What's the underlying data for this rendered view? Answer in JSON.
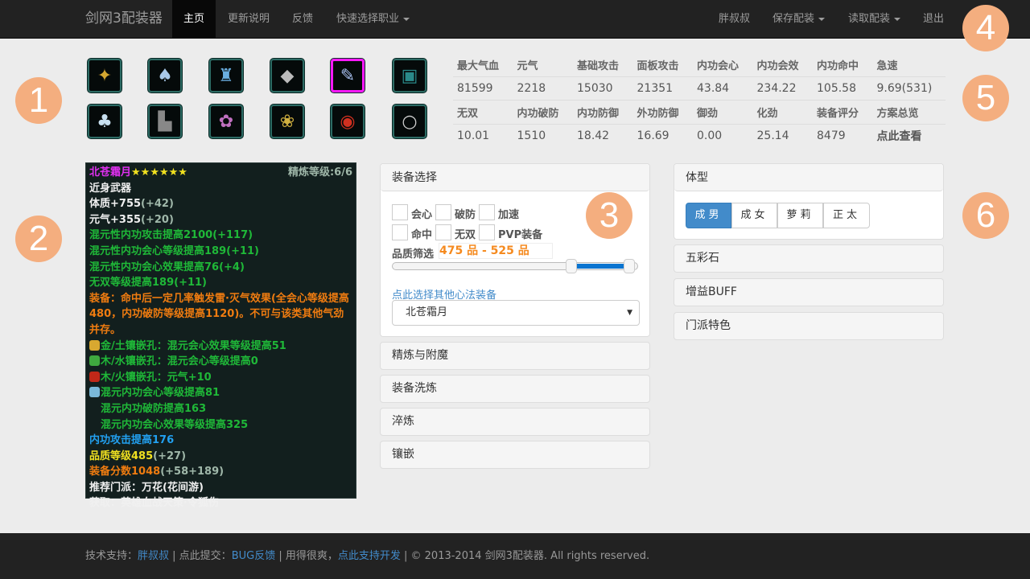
{
  "navbar": {
    "brand": "剑网3配装器",
    "items": [
      "主页",
      "更新说明",
      "反馈",
      "快速选择职业"
    ],
    "right_items": [
      "胖叔叔",
      "保存配装",
      "读取配装",
      "退出"
    ]
  },
  "badges": [
    "1",
    "2",
    "3",
    "4",
    "5",
    "6"
  ],
  "equipment_slots": [
    {
      "slot": "necklace-ornament",
      "glyph": "✦",
      "color": "#d4a630"
    },
    {
      "slot": "chest",
      "glyph": "♠",
      "color": "#a8c8e8"
    },
    {
      "slot": "belt",
      "glyph": "♜",
      "color": "#6aaee0"
    },
    {
      "slot": "bracer",
      "glyph": "◆",
      "color": "#bbbbbb"
    },
    {
      "slot": "weapon",
      "glyph": "✎",
      "color": "#a8c0f0",
      "selected": true
    },
    {
      "slot": "hidden-weapon",
      "glyph": "▣",
      "color": "#2a8a8a"
    },
    {
      "slot": "pants",
      "glyph": "♣",
      "color": "#c8e0f0"
    },
    {
      "slot": "shoes",
      "glyph": "▙",
      "color": "#888888"
    },
    {
      "slot": "pendant",
      "glyph": "✿",
      "color": "#c070c0"
    },
    {
      "slot": "waist-pendant",
      "glyph": "❀",
      "color": "#d0b040"
    },
    {
      "slot": "ring-1",
      "glyph": "◉",
      "color": "#d03020"
    },
    {
      "slot": "ring-2",
      "glyph": "○",
      "color": "#d0d0d0"
    }
  ],
  "stats": {
    "row1_labels": [
      "最大气血",
      "元气",
      "基础攻击",
      "面板攻击",
      "内功会心",
      "内功会效",
      "内功命中",
      "急速"
    ],
    "row1_values": [
      "81599",
      "2218",
      "15030",
      "21351",
      "43.84",
      "234.22",
      "105.58",
      "9.69(531)"
    ],
    "row2_labels": [
      "无双",
      "内功破防",
      "内功防御",
      "外功防御",
      "御劲",
      "化劲",
      "装备评分",
      "方案总览"
    ],
    "row2_values": [
      "10.01",
      "1510",
      "18.42",
      "16.69",
      "0.00",
      "25.14",
      "8479"
    ],
    "overview_link": "点此查看"
  },
  "tooltip": {
    "name": "北苍霜月",
    "stars": "★★★★★★",
    "refine": "精炼等级:6/6",
    "type": "近身武器",
    "base": [
      {
        "text": "体质+755",
        "extra": "(+42)"
      },
      {
        "text": "元气+355",
        "extra": "(+20)"
      }
    ],
    "green": [
      "混元性内功攻击提高2100(+117)",
      "混元性内功会心等级提高189(+11)",
      "混元性内功会心效果提高76(+4)",
      "无双等级提高189(+11)"
    ],
    "effect": "装备：命中后一定几率触发雷·灭气效果(全会心等级提高480，内功破防等级提高1120)。不可与该类其他气劲并存。",
    "sockets": [
      {
        "text": "金/土镶嵌孔：混元会心效果等级提高51",
        "color": "#d8a830"
      },
      {
        "text": "木/水镶嵌孔：混元会心等级提高0",
        "color": "#3fa83f"
      },
      {
        "text": "木/火镶嵌孔：元气+10",
        "color": "#c02818"
      }
    ],
    "enchant": [
      "混元内功会心等级提高81",
      "混元内功破防提高163",
      "混元内功会心效果等级提高325"
    ],
    "enchant_color": "#7ab8d8",
    "attack_bonus": "内功攻击提高176",
    "quality_label": "品质等级485",
    "quality_extra": "(+27)",
    "score_label": "装备分数1048",
    "score_extra": "(+58+189)",
    "school": "推荐门派：万花(花间游)",
    "source": "获取：英雄血战天策·令狐伤"
  },
  "equip_select": {
    "title": "装备选择",
    "checkboxes": [
      "会心",
      "破防",
      "加速",
      "命中",
      "无双",
      "PVP装备"
    ],
    "quality_label": "品质筛选",
    "quality_range": "475 品 - 525 品",
    "slider_low_fraction": 0.73,
    "slider_high_fraction": 0.97,
    "other_link": "点此选择其他心法装备",
    "selected_item": "北苍霜月"
  },
  "middle_sections": [
    "精炼与附魔",
    "装备洗炼",
    "淬炼",
    "镶嵌"
  ],
  "body_type": {
    "title": "体型",
    "options": [
      "成男",
      "成女",
      "萝莉",
      "正太"
    ],
    "active": 0
  },
  "right_sections": [
    "五彩石",
    "增益BUFF",
    "门派特色"
  ],
  "footer": {
    "support_label": "技术支持：",
    "support_link": "胖叔叔",
    "sep1": " | 点此提交：",
    "bug_link": "BUG反馈",
    "sep2": " | 用得很爽，",
    "donate_link": "点此支持开发",
    "copyright": " | © 2013-2014 剑网3配装器. All rights reserved."
  },
  "colors": {
    "accent": "#428bca",
    "badge": "#f4ae7f",
    "navbar": "#222222",
    "selected_slot": "#ff19ff"
  }
}
